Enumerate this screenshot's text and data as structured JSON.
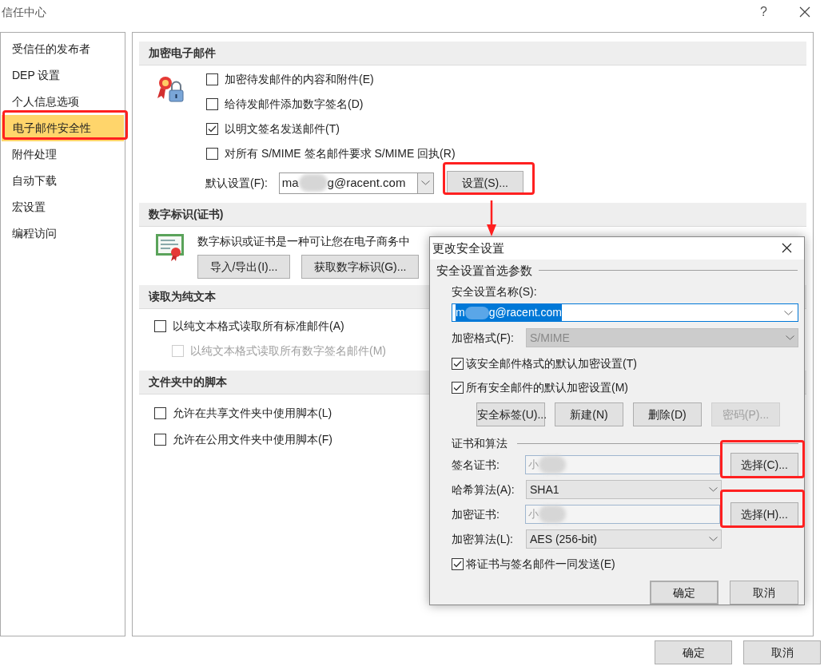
{
  "window": {
    "title": "信任中心",
    "help": "?"
  },
  "sidebar": {
    "items": [
      {
        "label": "受信任的发布者",
        "selected": false
      },
      {
        "label": "DEP 设置",
        "selected": false
      },
      {
        "label": "个人信息选项",
        "selected": false
      },
      {
        "label": "电子邮件安全性",
        "selected": true
      },
      {
        "label": "附件处理",
        "selected": false
      },
      {
        "label": "自动下载",
        "selected": false
      },
      {
        "label": "宏设置",
        "selected": false
      },
      {
        "label": "编程访问",
        "selected": false
      }
    ]
  },
  "encrypted_email": {
    "title": "加密电子邮件",
    "options": [
      {
        "label": "加密待发邮件的内容和附件(E)",
        "checked": false
      },
      {
        "label": "给待发邮件添加数字签名(D)",
        "checked": false
      },
      {
        "label": "以明文签名发送邮件(T)",
        "checked": true
      },
      {
        "label": "对所有 S/MIME 签名邮件要求 S/MIME 回执(R)",
        "checked": false
      }
    ],
    "default_setting": {
      "label": "默认设置(F):",
      "value_start": "ma",
      "value_end": "g@racent.com"
    },
    "settings_button": "设置(S)..."
  },
  "digital_ids": {
    "title": "数字标识(证书)",
    "description": "数字标识或证书是一种可让您在电子商务中",
    "buttons": [
      "导入/导出(I)...",
      "获取数字标识(G)..."
    ]
  },
  "read_as_plain_text": {
    "title": "读取为纯文本",
    "options": [
      {
        "label": "以纯文本格式读取所有标准邮件(A)",
        "checked": false,
        "disabled": false,
        "children": [
          {
            "label": "以纯文本格式读取所有数字签名邮件(M)",
            "checked": false,
            "disabled": true
          }
        ]
      }
    ]
  },
  "folder_scripts": {
    "title": "文件夹中的脚本",
    "options": [
      {
        "label": "允许在共享文件夹中使用脚本(L)",
        "checked": false
      },
      {
        "label": "允许在公用文件夹中使用脚本(F)",
        "checked": false
      }
    ]
  },
  "footer_buttons": [
    "确定",
    "取消"
  ],
  "dialog": {
    "title": "更改安全设置",
    "preferences": {
      "title": "安全设置首选参数",
      "name_label": "安全设置名称(S):",
      "name_value_start": "m",
      "name_value_end": "g@racent.com",
      "format_label": "加密格式(F):",
      "format_value": "S/MIME",
      "format_disabled": true,
      "options": [
        {
          "label": "该安全邮件格式的默认加密设置(T)",
          "checked": true
        },
        {
          "label": "所有安全邮件的默认加密设置(M)",
          "checked": true
        }
      ],
      "buttons": [
        {
          "label": "安全标签(U)...",
          "disabled": false
        },
        {
          "label": "新建(N)",
          "disabled": false
        },
        {
          "label": "删除(D)",
          "disabled": false
        },
        {
          "label": "密码(P)...",
          "disabled": true
        }
      ]
    },
    "certificates": {
      "title": "证书和算法",
      "rows": [
        {
          "kind": "cert",
          "label": "签名证书:",
          "value_start": "小",
          "button": "选择(C)..."
        },
        {
          "kind": "select",
          "label": "哈希算法(A):",
          "value": "SHA1"
        },
        {
          "kind": "cert",
          "label": "加密证书:",
          "value_start": "小",
          "button": "选择(H)..."
        },
        {
          "kind": "select",
          "label": "加密算法(L):",
          "value": "AES (256-bit)"
        }
      ],
      "send_cert": {
        "label": "将证书与签名邮件一同发送(E)",
        "checked": true
      }
    },
    "ok": "确定",
    "cancel": "取消"
  }
}
